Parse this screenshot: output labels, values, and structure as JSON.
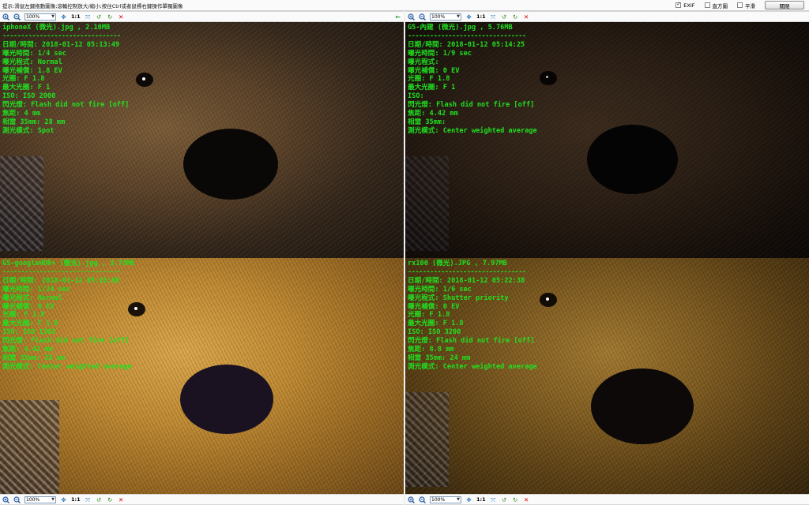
{
  "topbar": {
    "hint": "提示:滑鼠左鍵拖動圖像;滾輪控制放大/縮小;按住Ctrl或者鼠標右鍵操作單獨圖像",
    "options": [
      {
        "label": "EXIF",
        "checked": true
      },
      {
        "label": "直方圖",
        "checked": false
      },
      {
        "label": "平滑",
        "checked": false
      }
    ],
    "close_label": "關閉"
  },
  "toolbar": {
    "zoom_value": "100%",
    "ratio_label": "1:1",
    "icons": [
      "zoom-in-icon",
      "zoom-out-icon",
      "pan-icon",
      "fit-icon",
      "rotate-left-icon",
      "rotate-right-icon",
      "close-icon"
    ]
  },
  "separator": "--------------------------------",
  "colors": {
    "exif_text": "#20e020",
    "close_red": "#d80000",
    "arrow_green": "#1d9b2f"
  },
  "panes": [
    {
      "title": "iphoneX (微光).jpg , 2.10MB",
      "lines": [
        "日期/時間: 2018-01-12 05:13:49",
        "曝光時間: 1/4 sec",
        "曝光程式: Normal",
        "曝光補償: 1.8 EV",
        "光圈: F 1.8",
        "最大光圈: F 1",
        "ISO: ISO 2000",
        "閃光燈: Flash did not fire [off]",
        "焦距: 4 mm",
        "相當 35mm: 28 mm",
        "測光模式: Spot"
      ]
    },
    {
      "title": "G5-內建 (微光).jpg , 5.76MB",
      "lines": [
        "日期/時間: 2018-01-12 05:14:25",
        "曝光時間: 1/9 sec",
        "曝光程式:",
        "曝光補償: 0 EV",
        "光圈: F 1.8",
        "最大光圈: F 1",
        "ISO:",
        "閃光燈: Flash did not fire [off]",
        "焦距: 4.42 mm",
        "相當 35mm:",
        "測光模式: Center weighted average"
      ]
    },
    {
      "title": "G5-googleHDR+ (微光).jpg , 3.73MB",
      "lines": [
        "日期/時間: 2018-01-12 05:16:00",
        "曝光時間: 1/24 sec",
        "曝光程式: Normal",
        "曝光補償: 0 EV",
        "光圈: F 1.8",
        "最大光圈: F 1.8",
        "ISO: ISO 1363",
        "閃光燈: Flash did not fire [off]",
        "焦距: 4.42 mm",
        "相當 35mm: 28 mm",
        "測光模式: Center weighted average"
      ]
    },
    {
      "title": "rx100 (微光).JPG , 7.97MB",
      "lines": [
        "日期/時間: 2018-01-12 05:22:38",
        "曝光時間: 1/6 sec",
        "曝光程式: Shutter priority",
        "曝光補償: 0 EV",
        "光圈: F 1.8",
        "最大光圈: F 1.8",
        "ISO: ISO 3200",
        "閃光燈: Flash did not fire [off]",
        "焦距: 8.8 mm",
        "相當 35mm: 24 mm",
        "測光模式: Center weighted average"
      ]
    }
  ]
}
